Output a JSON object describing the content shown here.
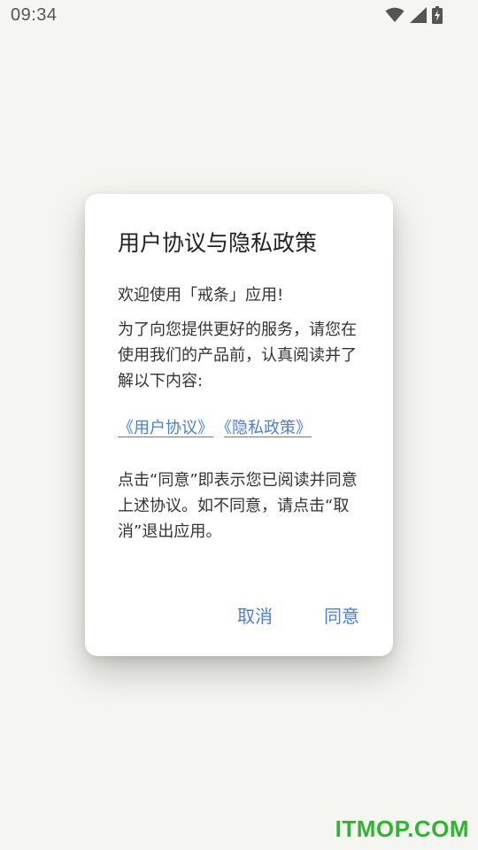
{
  "status_bar": {
    "time": "09:34",
    "icons": [
      "wifi-icon",
      "cell-signal-icon",
      "battery-charging-icon"
    ]
  },
  "dialog": {
    "title": "用户协议与隐私政策",
    "welcome": "欢迎使用「戒条」应用!",
    "intro": "为了向您提供更好的服务，请您在使用我们的产品前，认真阅读并了解以下内容:",
    "links": {
      "user_agreement": "《用户协议》",
      "privacy_policy": "《隐私政策》"
    },
    "notice": "点击“同意”即表示您已阅读并同意上述协议。如不同意，请点击“取消”退出应用。",
    "cancel_label": "取消",
    "agree_label": "同意"
  },
  "watermark": "ITMOP.COM",
  "colors": {
    "background": "#f5f5f2",
    "accent": "#4a7fd4",
    "watermark": "#32b432"
  }
}
